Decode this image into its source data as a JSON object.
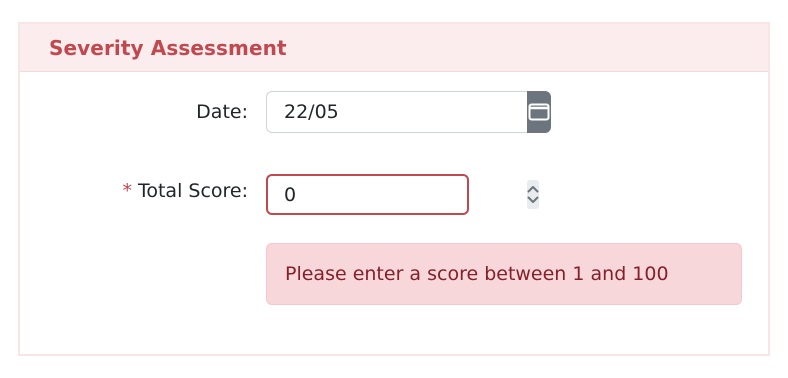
{
  "panel": {
    "title": "Severity Assessment"
  },
  "date_field": {
    "label": "Date:",
    "value": "22/05",
    "icon": "calendar-icon"
  },
  "score_field": {
    "required_marker": "*",
    "label": "Total Score:",
    "value": "0",
    "icon": "spinner-icon"
  },
  "validation": {
    "message": "Please enter a score between 1 and 100"
  },
  "colors": {
    "accent": "#c0484f",
    "header_bg": "#fbecee",
    "button_bg": "#6c757d",
    "alert_bg": "#f8d7da",
    "alert_text": "#842029"
  }
}
